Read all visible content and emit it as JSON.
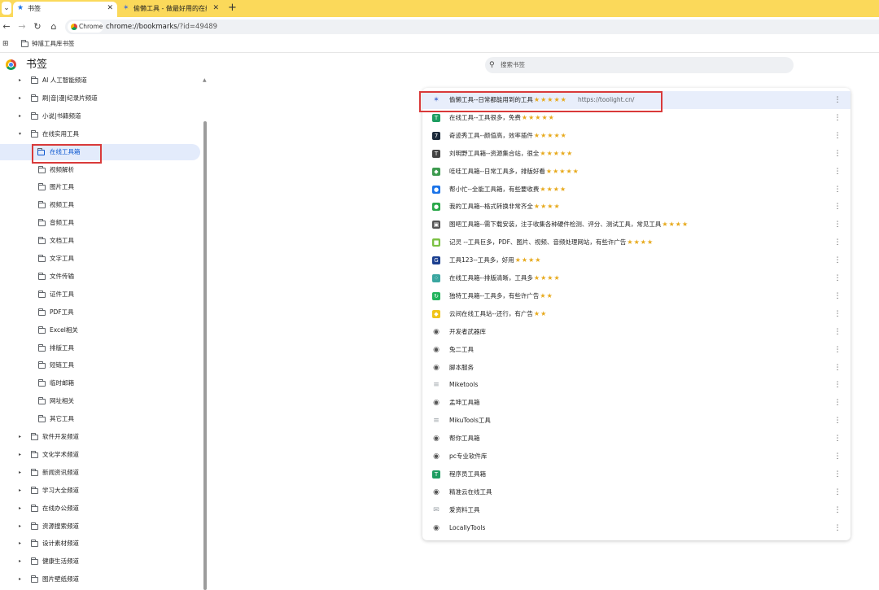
{
  "browser": {
    "tabs": [
      {
        "title": "书签",
        "favicon": "star-icon",
        "close": "✕"
      },
      {
        "title": "偷懒工具 - 做最好用的在线工具",
        "favicon": "yx-logo-icon",
        "close": "✕"
      }
    ],
    "new_tab": "+",
    "chip_label": "Chrome",
    "url_scheme_host": "chrome://bookmarks",
    "url_rest": "/?id=49489",
    "bookmarks_bar_item": "钟馗工具库书签"
  },
  "page": {
    "title": "书签",
    "search_placeholder": "搜索书签"
  },
  "sidebar": {
    "items": [
      {
        "label": "AI 人工智能频道",
        "level": 1,
        "arrow": "▸"
      },
      {
        "label": "刷|音|漫|纪录片频道",
        "level": 1,
        "arrow": "▸"
      },
      {
        "label": "小说|书籍频道",
        "level": 1,
        "arrow": "▸"
      },
      {
        "label": "在线实用工具",
        "level": 1,
        "arrow": "▾"
      },
      {
        "label": "在线工具箱",
        "level": 2,
        "selected": true
      },
      {
        "label": "视频解析",
        "level": 2
      },
      {
        "label": "图片工具",
        "level": 2
      },
      {
        "label": "视频工具",
        "level": 2
      },
      {
        "label": "音频工具",
        "level": 2
      },
      {
        "label": "文档工具",
        "level": 2
      },
      {
        "label": "文字工具",
        "level": 2
      },
      {
        "label": "文件传输",
        "level": 2
      },
      {
        "label": "证件工具",
        "level": 2
      },
      {
        "label": "PDF工具",
        "level": 2
      },
      {
        "label": "Excel相关",
        "level": 2
      },
      {
        "label": "排版工具",
        "level": 2
      },
      {
        "label": "短链工具",
        "level": 2
      },
      {
        "label": "临时邮箱",
        "level": 2
      },
      {
        "label": "网址相关",
        "level": 2
      },
      {
        "label": "其它工具",
        "level": 2
      },
      {
        "label": "软件开发频道",
        "level": 1,
        "arrow": "▸"
      },
      {
        "label": "文化学术频道",
        "level": 1,
        "arrow": "▸"
      },
      {
        "label": "新闻资讯频道",
        "level": 1,
        "arrow": "▸"
      },
      {
        "label": "学习大全频道",
        "level": 1,
        "arrow": "▸"
      },
      {
        "label": "在线办公频道",
        "level": 1,
        "arrow": "▸"
      },
      {
        "label": "资源搜索频道",
        "level": 1,
        "arrow": "▸"
      },
      {
        "label": "设计素材频道",
        "level": 1,
        "arrow": "▸"
      },
      {
        "label": "健康生活频道",
        "level": 1,
        "arrow": "▸"
      },
      {
        "label": "图片壁纸频道",
        "level": 1,
        "arrow": "▸"
      }
    ]
  },
  "bookmarks": [
    {
      "title": "偷懒工具--日常都能用到的工具",
      "stars": "★★★★★",
      "url": "https://toolight.cn/",
      "icon": "yx-logo-icon",
      "color": "#4a6fd1",
      "glyph": "✶",
      "highlight": true
    },
    {
      "title": "在线工具--工具很多，免费",
      "stars": "★★★★★",
      "icon": "toolbox-icon",
      "color": "#1e9d61",
      "glyph": "T"
    },
    {
      "title": "奇迹秀工具--颜值高，效率插件",
      "stars": "★★★★★",
      "icon": "qijixiu-icon",
      "color": "#1b2a3a",
      "glyph": "7"
    },
    {
      "title": "刘明野工具箱--资源集合站，很全",
      "stars": "★★★★★",
      "icon": "t-letter-icon",
      "color": "#444444",
      "glyph": "T"
    },
    {
      "title": "哇哇工具箱--日常工具多，排版好看",
      "stars": "★★★★★",
      "icon": "wawa-icon",
      "color": "#3c9a4e",
      "glyph": "◆"
    },
    {
      "title": "帮小忙--全能工具箱，有些要收费",
      "stars": "★★★★",
      "icon": "cloud-icon",
      "color": "#1a73e8",
      "glyph": "●"
    },
    {
      "title": "我的工具箱--格式转换非常齐全",
      "stars": "★★★★",
      "icon": "green-circle-icon",
      "color": "#2aa84a",
      "glyph": "●"
    },
    {
      "title": "图吧工具箱--需下载安装，注于收集各种硬件检测、评分、测试工具，常见工具",
      "stars": "★★★★",
      "icon": "monitor-icon",
      "color": "#555555",
      "glyph": "▣"
    },
    {
      "title": "记灵 --工具巨多，PDF、图片、视频、音频处理网站，有些许广告",
      "stars": "★★★★",
      "icon": "jiling-icon",
      "color": "#7bc043",
      "glyph": "■"
    },
    {
      "title": "工具123--工具多，好用",
      "stars": "★★★★",
      "icon": "g-letter-icon",
      "color": "#1b3f8f",
      "glyph": "G"
    },
    {
      "title": "在线工具箱--排版清晰，工具多",
      "stars": "★★★★",
      "icon": "grid-icon",
      "color": "#3aa6a0",
      "glyph": "⁘"
    },
    {
      "title": "独特工具箱--工具多，有些许广告",
      "stars": "★★",
      "icon": "green-refresh-icon",
      "color": "#21b35c",
      "glyph": "↻"
    },
    {
      "title": "云间在线工具站--还行，有广告",
      "stars": "★★",
      "icon": "pikachu-icon",
      "color": "#f0c419",
      "glyph": "◆"
    },
    {
      "title": "开发者武器库",
      "icon": "globe-icon",
      "color": "#555555",
      "glyph": "◉"
    },
    {
      "title": "兔二工具",
      "icon": "globe-icon",
      "color": "#555555",
      "glyph": "◉"
    },
    {
      "title": "脚本服务",
      "icon": "globe-icon",
      "color": "#555555",
      "glyph": "◉"
    },
    {
      "title": "Miketools",
      "icon": "miketools-icon",
      "color": "#9aa0a6",
      "glyph": "≡"
    },
    {
      "title": "孟坤工具箱",
      "icon": "globe-icon",
      "color": "#555555",
      "glyph": "◉"
    },
    {
      "title": "MikuTools工具",
      "icon": "mikutools-icon",
      "color": "#9aa0a6",
      "glyph": "≡"
    },
    {
      "title": "帮你工具箱",
      "icon": "globe-icon",
      "color": "#555555",
      "glyph": "◉"
    },
    {
      "title": "pc专业软件库",
      "icon": "globe-icon",
      "color": "#555555",
      "glyph": "◉"
    },
    {
      "title": "程序员工具箱",
      "icon": "toolbox-icon",
      "color": "#1e9d61",
      "glyph": "T"
    },
    {
      "title": "精准云在线工具",
      "icon": "globe-icon",
      "color": "#555555",
      "glyph": "◉"
    },
    {
      "title": "爱资料工具",
      "icon": "mail-icon",
      "color": "#9aa0a6",
      "glyph": "✉"
    },
    {
      "title": "LocallyTools",
      "icon": "globe-icon",
      "color": "#555555",
      "glyph": "◉"
    }
  ],
  "more_glyph": "⋮",
  "colors": {
    "tabbar": "#fbd95a",
    "accent": "#0b57d0",
    "selected_bg": "#e3ebfb",
    "annotation_red": "#d93a3a",
    "star": "#e7a91b"
  }
}
